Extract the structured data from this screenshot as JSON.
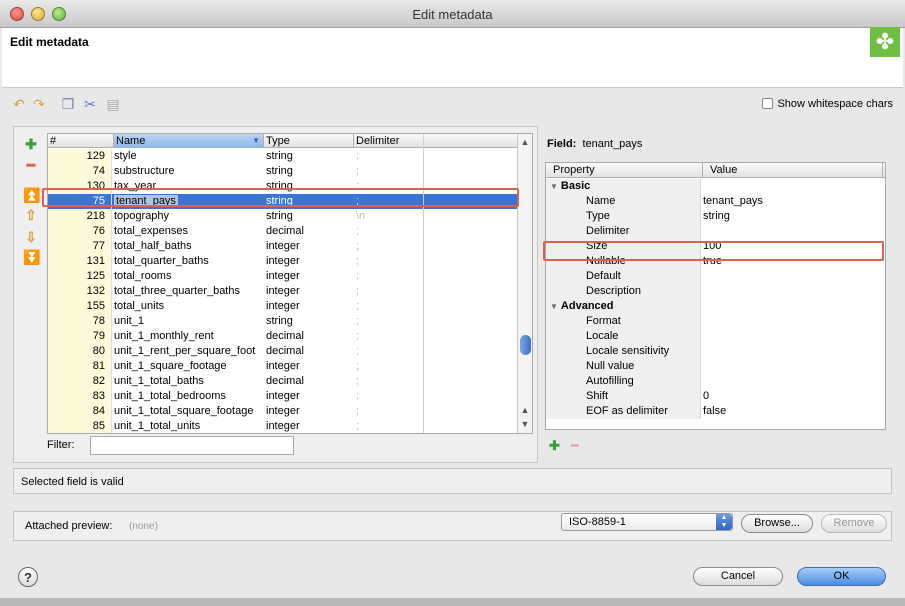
{
  "window": {
    "title": "Edit metadata"
  },
  "header": {
    "title": "Edit metadata",
    "logo_icon": "clover-icon"
  },
  "toolbar": {
    "icons": [
      "undo-icon",
      "redo-icon",
      "copy-icon",
      "cut-icon",
      "paste-icon"
    ],
    "show_whitespace_label": "Show whitespace chars",
    "show_whitespace_checked": false
  },
  "grid": {
    "columns": [
      "#",
      "Name",
      "Type",
      "Delimiter"
    ],
    "rows": [
      {
        "num": "129",
        "name": "style",
        "type": "string",
        "delim": ";"
      },
      {
        "num": "74",
        "name": "substructure",
        "type": "string",
        "delim": ";"
      },
      {
        "num": "130",
        "name": "tax_year",
        "type": "string",
        "delim": ";"
      },
      {
        "num": "75",
        "name": "tenant_pays",
        "type": "string",
        "delim": ";"
      },
      {
        "num": "218",
        "name": "topography",
        "type": "string",
        "delim": "\\n"
      },
      {
        "num": "76",
        "name": "total_expenses",
        "type": "decimal",
        "delim": ";"
      },
      {
        "num": "77",
        "name": "total_half_baths",
        "type": "integer",
        "delim": ";"
      },
      {
        "num": "131",
        "name": "total_quarter_baths",
        "type": "integer",
        "delim": ";"
      },
      {
        "num": "125",
        "name": "total_rooms",
        "type": "integer",
        "delim": ";"
      },
      {
        "num": "132",
        "name": "total_three_quarter_baths",
        "type": "integer",
        "delim": ";"
      },
      {
        "num": "155",
        "name": "total_units",
        "type": "integer",
        "delim": ";"
      },
      {
        "num": "78",
        "name": "unit_1",
        "type": "string",
        "delim": ";"
      },
      {
        "num": "79",
        "name": "unit_1_monthly_rent",
        "type": "decimal",
        "delim": ";"
      },
      {
        "num": "80",
        "name": "unit_1_rent_per_square_foot",
        "type": "decimal",
        "delim": ";"
      },
      {
        "num": "81",
        "name": "unit_1_square_footage",
        "type": "integer",
        "delim": ";"
      },
      {
        "num": "82",
        "name": "unit_1_total_baths",
        "type": "decimal",
        "delim": ";"
      },
      {
        "num": "83",
        "name": "unit_1_total_bedrooms",
        "type": "integer",
        "delim": ";"
      },
      {
        "num": "84",
        "name": "unit_1_total_square_footage",
        "type": "integer",
        "delim": ";"
      },
      {
        "num": "85",
        "name": "unit_1_total_units",
        "type": "integer",
        "delim": ";"
      }
    ],
    "selected_index": 3,
    "filter_label": "Filter:",
    "filter_value": ""
  },
  "field": {
    "label": "Field:",
    "name": "tenant_pays"
  },
  "properties": {
    "columns": [
      "Property",
      "Value"
    ],
    "rows": [
      {
        "key": "Basic",
        "value": "",
        "group": true
      },
      {
        "key": "Name",
        "value": "tenant_pays"
      },
      {
        "key": "Type",
        "value": "string"
      },
      {
        "key": "Delimiter",
        "value": ""
      },
      {
        "key": "Size",
        "value": "100"
      },
      {
        "key": "Nullable",
        "value": "true"
      },
      {
        "key": "Default",
        "value": ""
      },
      {
        "key": "Description",
        "value": ""
      },
      {
        "key": "Advanced",
        "value": "",
        "group": true
      },
      {
        "key": "Format",
        "value": ""
      },
      {
        "key": "Locale",
        "value": ""
      },
      {
        "key": "Locale sensitivity",
        "value": ""
      },
      {
        "key": "Null value",
        "value": ""
      },
      {
        "key": "Autofilling",
        "value": ""
      },
      {
        "key": "Shift",
        "value": "0"
      },
      {
        "key": "EOF as delimiter",
        "value": "false"
      }
    ]
  },
  "status": {
    "text": "Selected field is valid"
  },
  "preview": {
    "label": "Attached preview:",
    "value": "(none)",
    "encoding": "ISO-8859-1",
    "browse_label": "Browse...",
    "remove_label": "Remove"
  },
  "footer": {
    "cancel_label": "Cancel",
    "ok_label": "OK",
    "help_label": "?"
  },
  "colors": {
    "selection": "#3875d7",
    "highlight_box": "#e0604f",
    "accent_green": "#6fbf44"
  }
}
